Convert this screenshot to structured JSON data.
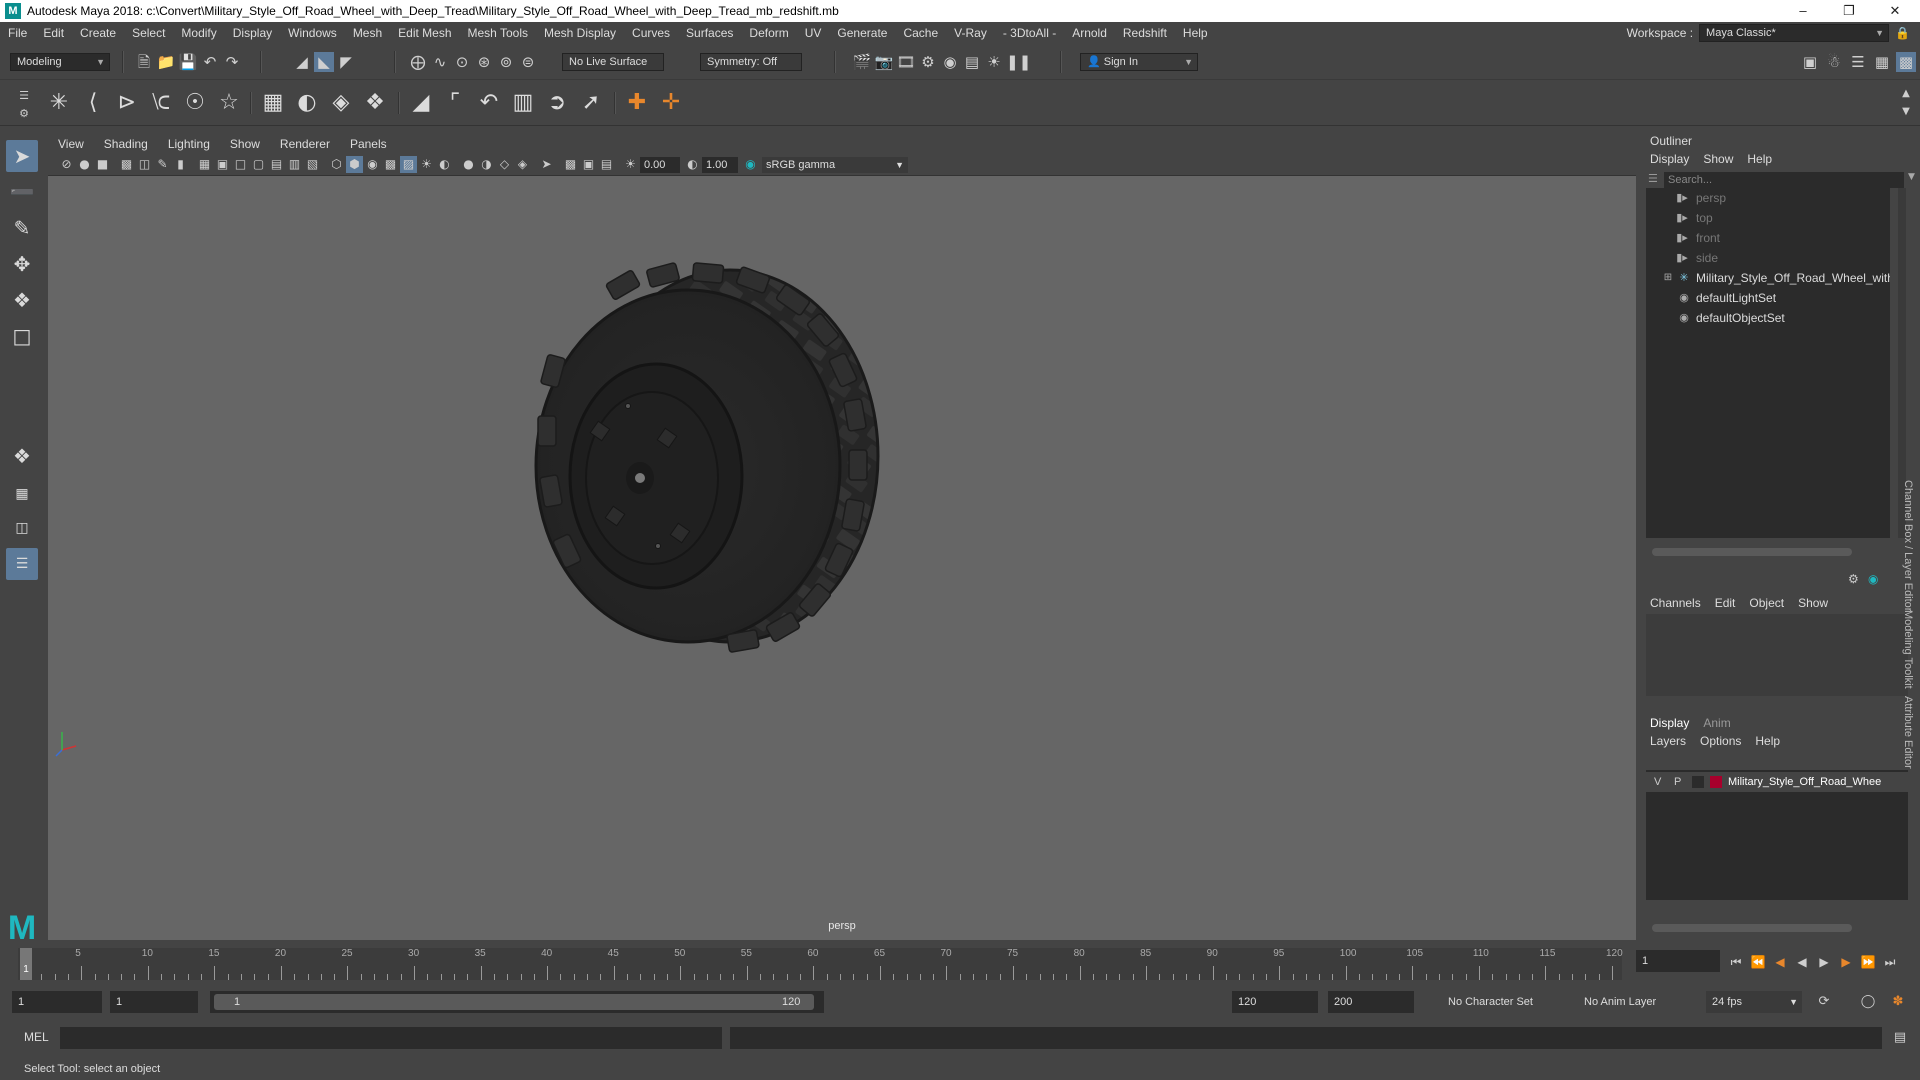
{
  "window": {
    "title": "Autodesk Maya 2018: c:\\Convert\\Military_Style_Off_Road_Wheel_with_Deep_Tread\\Military_Style_Off_Road_Wheel_with_Deep_Tread_mb_redshift.mb",
    "app_icon_letter": "M"
  },
  "menubar": {
    "items": [
      "File",
      "Edit",
      "Create",
      "Select",
      "Modify",
      "Display",
      "Windows",
      "Mesh",
      "Edit Mesh",
      "Mesh Tools",
      "Mesh Display",
      "Curves",
      "Surfaces",
      "Deform",
      "UV",
      "Generate",
      "Cache",
      "V-Ray",
      "- 3DtoAll -",
      "Arnold",
      "Redshift",
      "Help"
    ],
    "workspace_label": "Workspace :",
    "workspace_value": "Maya Classic*"
  },
  "statusline": {
    "mode": "Modeling",
    "live_surface": "No Live Surface",
    "symmetry": "Symmetry: Off",
    "sign_in": "Sign In"
  },
  "viewport": {
    "menu": [
      "View",
      "Shading",
      "Lighting",
      "Show",
      "Renderer",
      "Panels"
    ],
    "exposure": "0.00",
    "gamma": "1.00",
    "color_space": "sRGB gamma",
    "camera_label": "persp"
  },
  "outliner": {
    "title": "Outliner",
    "menu": [
      "Display",
      "Show",
      "Help"
    ],
    "search_placeholder": "Search...",
    "items": [
      {
        "label": "persp",
        "icon": "camera-icon",
        "dim": true
      },
      {
        "label": "top",
        "icon": "camera-icon",
        "dim": true
      },
      {
        "label": "front",
        "icon": "camera-icon",
        "dim": true
      },
      {
        "label": "side",
        "icon": "camera-icon",
        "dim": true
      },
      {
        "label": "Military_Style_Off_Road_Wheel_with_De",
        "icon": "transform-icon",
        "dim": false
      },
      {
        "label": "defaultLightSet",
        "icon": "set-icon",
        "dim": false
      },
      {
        "label": "defaultObjectSet",
        "icon": "set-icon",
        "dim": false
      }
    ]
  },
  "channelbox": {
    "menu": [
      "Channels",
      "Edit",
      "Object",
      "Show"
    ]
  },
  "layers": {
    "tabs": [
      "Display",
      "Anim"
    ],
    "menu": [
      "Layers",
      "Options",
      "Help"
    ],
    "layer": {
      "v": "V",
      "p": "P",
      "name": "Military_Style_Off_Road_Whee",
      "color": "#a8002c"
    }
  },
  "side_tabs": [
    "Channel Box / Layer Editor",
    "Modeling Toolkit",
    "Attribute Editor"
  ],
  "timeline": {
    "ticks": [
      "5",
      "10",
      "15",
      "20",
      "25",
      "30",
      "35",
      "40",
      "45",
      "50",
      "55",
      "60",
      "65",
      "70",
      "75",
      "80",
      "85",
      "90",
      "95",
      "100",
      "105",
      "110",
      "115",
      "120"
    ],
    "current_frame": "1",
    "start_marker": "1"
  },
  "rangebar": {
    "start": "1",
    "playback_start": "1",
    "range_start": "1",
    "range_end": "120",
    "playback_end": "120",
    "end": "200",
    "character_set": "No Character Set",
    "anim_layer": "No Anim Layer",
    "fps": "24 fps"
  },
  "cmdline": {
    "label": "MEL"
  },
  "helpline": {
    "text": "Select Tool: select an object"
  },
  "colors": {
    "accent": "#5c7a99",
    "viewport_bg": "#666666",
    "panel_bg": "#444444",
    "field_bg": "#2b2b2b"
  }
}
